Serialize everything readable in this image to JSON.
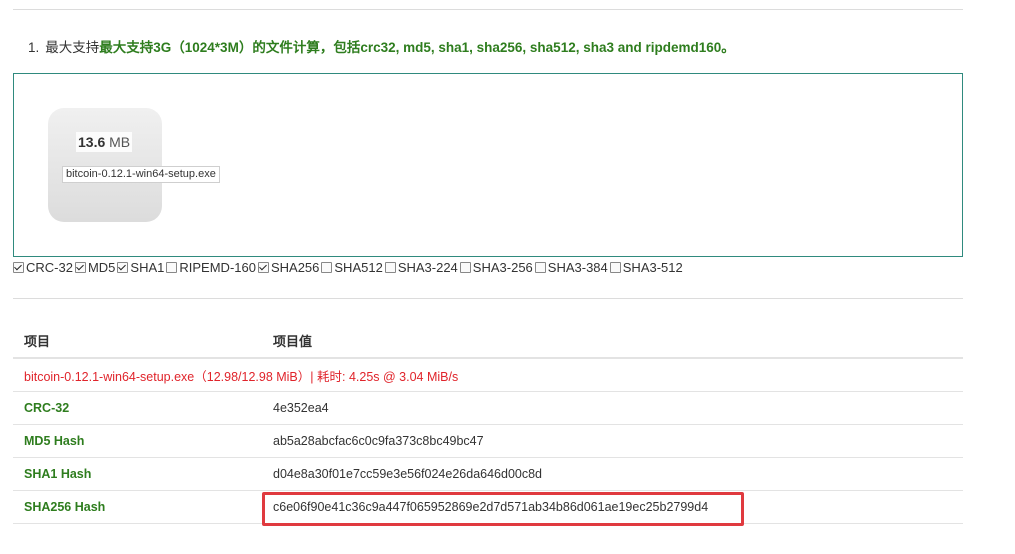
{
  "intro": {
    "number": "1.",
    "prefix": "最大支持",
    "bold_text": "最大支持3G（1024*3M）的文件计算，包括crc32, md5, sha1, sha256, sha512, sha3 and ripdemd160。"
  },
  "file": {
    "size_value": "13.6",
    "size_unit": "MB",
    "name": "bitcoin-0.12.1-win64-setup.exe"
  },
  "algorithms": [
    {
      "label": "CRC-32",
      "checked": true
    },
    {
      "label": "MD5",
      "checked": true
    },
    {
      "label": "SHA1",
      "checked": true
    },
    {
      "label": "RIPEMD-160",
      "checked": false
    },
    {
      "label": "SHA256",
      "checked": true
    },
    {
      "label": "SHA512",
      "checked": false
    },
    {
      "label": "SHA3-224",
      "checked": false
    },
    {
      "label": "SHA3-256",
      "checked": false
    },
    {
      "label": "SHA3-384",
      "checked": false
    },
    {
      "label": "SHA3-512",
      "checked": false
    }
  ],
  "table": {
    "headers": [
      "项目",
      "项目值"
    ],
    "file_row": "bitcoin-0.12.1-win64-setup.exe（12.98/12.98 MiB）| 耗时: 4.25s @ 3.04 MiB/s",
    "rows": [
      {
        "key": "CRC-32",
        "value": "4e352ea4"
      },
      {
        "key": "MD5 Hash",
        "value": "ab5a28abcfac6c0c9fa373c8bc49bc47"
      },
      {
        "key": "SHA1 Hash",
        "value": "d04e8a30f01e7cc59e3e56f024e26da646d00c8d"
      },
      {
        "key": "SHA256 Hash",
        "value": "c6e06f90e41c36c9a447f065952869e2d7d571ab34b86d061ae19ec25b2799d4"
      }
    ]
  },
  "colors": {
    "accent_green": "#2e7d1e",
    "error_red": "#e0242b",
    "highlight_red": "#e03a3f"
  }
}
